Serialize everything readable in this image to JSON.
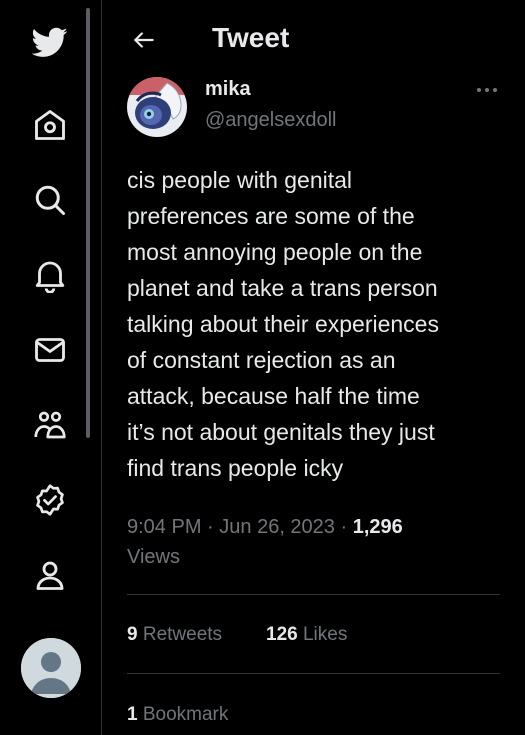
{
  "nav": {
    "items": [
      {
        "name": "twitter-logo-icon"
      },
      {
        "name": "home-icon"
      },
      {
        "name": "search-icon"
      },
      {
        "name": "notifications-icon"
      },
      {
        "name": "messages-icon"
      },
      {
        "name": "communities-icon"
      },
      {
        "name": "verified-icon"
      },
      {
        "name": "profile-icon"
      }
    ]
  },
  "header": {
    "title": "Tweet"
  },
  "tweet": {
    "author_name": "mika",
    "author_handle": "@angelsexdoll",
    "text_lines": [
      "cis people with genital",
      "preferences are some of the",
      "most annoying people on the",
      "planet and take a trans person",
      "talking about their experiences",
      "of constant rejection as an",
      "attack, because half the time",
      "it’s not about genitals they just",
      "find trans people icky"
    ],
    "time": "9:04 PM",
    "date": "Jun 26, 2023",
    "separator": " · ",
    "views_count": "1,296",
    "views_label": "Views",
    "retweets_count": "9",
    "retweets_label": "Retweets",
    "likes_count": "126",
    "likes_label": "Likes",
    "bookmarks_count": "1",
    "bookmarks_label": "Bookmark"
  },
  "colors": {
    "background": "#000000",
    "text": "#e7e9ea",
    "secondary_text": "#71767b",
    "divider": "#2f3336",
    "brand": "#1d9bf0"
  }
}
